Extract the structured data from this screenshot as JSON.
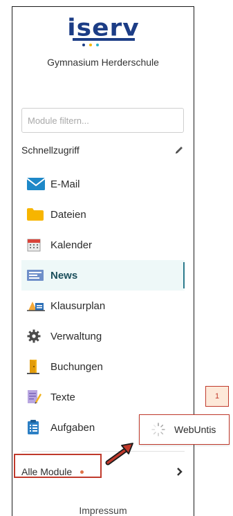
{
  "logo": {
    "text": "iserv",
    "dots": [
      "#1c3d86",
      "#f5b800",
      "#2ab3c9"
    ]
  },
  "school_name": "Gymnasium Herderschule",
  "filter": {
    "placeholder": "Module filtern..."
  },
  "quick_access": {
    "label": "Schnellzugriff",
    "edit_icon": "pencil-icon"
  },
  "menu": {
    "items": [
      {
        "label": "E-Mail",
        "icon": "envelope-icon"
      },
      {
        "label": "Dateien",
        "icon": "folder-icon"
      },
      {
        "label": "Kalender",
        "icon": "calendar-icon"
      },
      {
        "label": "News",
        "icon": "news-icon",
        "active": true
      },
      {
        "label": "Klausurplan",
        "icon": "exam-plan-icon"
      },
      {
        "label": "Verwaltung",
        "icon": "gear-icon"
      },
      {
        "label": "Buchungen",
        "icon": "door-icon"
      },
      {
        "label": "Texte",
        "icon": "text-document-icon"
      },
      {
        "label": "Aufgaben",
        "icon": "clipboard-icon"
      }
    ]
  },
  "all_modules": {
    "label": "Alle Module",
    "icon": "chevron-right-icon"
  },
  "footer": {
    "impressum": "Impressum"
  },
  "annotation": {
    "step": "1",
    "tooltip_label": "WebUntis",
    "tooltip_icon": "spinner-icon"
  },
  "colors": {
    "brand": "#1c3d86",
    "active_bg": "#eef8f8",
    "active_text": "#1b4f5c",
    "highlight": "#c0392b",
    "badge": "#e0734a"
  }
}
